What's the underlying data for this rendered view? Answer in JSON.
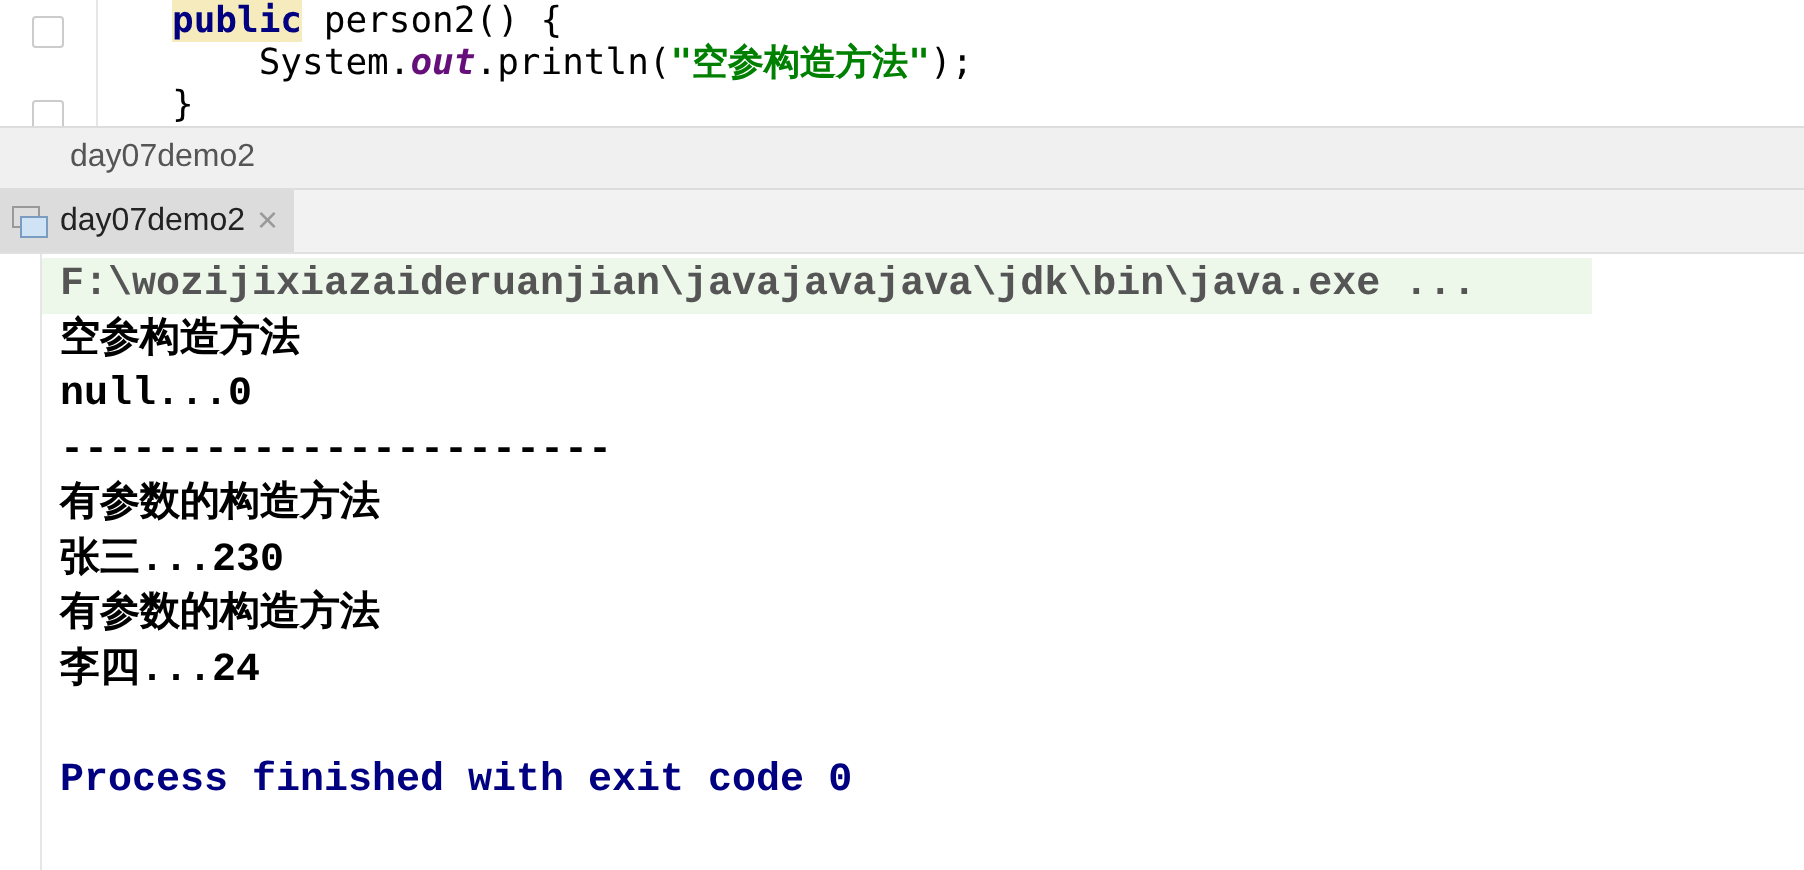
{
  "editor": {
    "lines": [
      {
        "segments": [
          {
            "kind": "keyword",
            "text": "public"
          },
          {
            "kind": "plain",
            "text": " person2() {"
          }
        ]
      },
      {
        "segments": [
          {
            "kind": "plain",
            "text": "    System."
          },
          {
            "kind": "static-field",
            "text": "out"
          },
          {
            "kind": "plain",
            "text": ".println("
          },
          {
            "kind": "string",
            "text": "\"空参构造方法\""
          },
          {
            "kind": "plain",
            "text": ");"
          }
        ]
      },
      {
        "segments": [
          {
            "kind": "plain",
            "text": "}"
          }
        ]
      }
    ]
  },
  "run_header": {
    "title": "day07demo2"
  },
  "tabs": [
    {
      "label": "day07demo2",
      "selected": true,
      "close": "×"
    }
  ],
  "console": {
    "lines": [
      {
        "kind": "command",
        "text": "F:\\wozijixiazaideruanjian\\javajavajava\\jdk\\bin\\java.exe ..."
      },
      {
        "kind": "output",
        "text": "空参构造方法"
      },
      {
        "kind": "output",
        "text": "null...0"
      },
      {
        "kind": "output",
        "text": "-----------------------"
      },
      {
        "kind": "output",
        "text": "有参数的构造方法"
      },
      {
        "kind": "output",
        "text": "张三...230"
      },
      {
        "kind": "output",
        "text": "有参数的构造方法"
      },
      {
        "kind": "output",
        "text": "李四...24"
      },
      {
        "kind": "blank"
      },
      {
        "kind": "exit",
        "text": "Process finished with exit code 0"
      }
    ]
  }
}
